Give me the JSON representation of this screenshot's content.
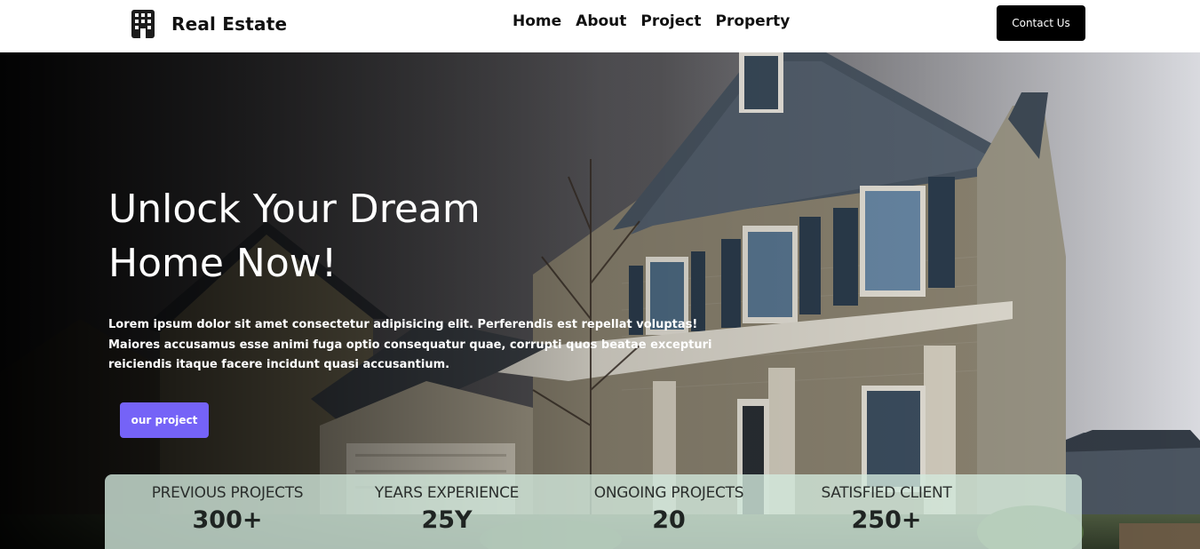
{
  "navbar": {
    "brand_name": "Real Estate",
    "brand_icon": "building-icon",
    "links": [
      {
        "label": "Home"
      },
      {
        "label": "About"
      },
      {
        "label": "Project"
      },
      {
        "label": "Property"
      }
    ],
    "contact_label": "Contact Us"
  },
  "hero": {
    "title": "Unlock Your Dream Home Now!",
    "description": "Lorem ipsum dolor sit amet consectetur adipisicing elit. Perferendis est repellat voluptas! Maiores accusamus esse animi fuga optio consequatur quae, corrupti quos beatae excepturi reiciendis itaque facere incidunt quasi accusantium.",
    "button_label": "our project",
    "background_image": "house-photo"
  },
  "stats": [
    {
      "label": "PREVIOUS PROJECTS",
      "value": "300+"
    },
    {
      "label": "YEARS EXPERIENCE",
      "value": "25Y"
    },
    {
      "label": "ONGOING PROJECTS",
      "value": "20"
    },
    {
      "label": "SATISFIED CLIENT",
      "value": "250+"
    }
  ],
  "colors": {
    "accent": "#7563f7",
    "contact_button": "#000000",
    "stats_panel": "#d2e8dc"
  }
}
